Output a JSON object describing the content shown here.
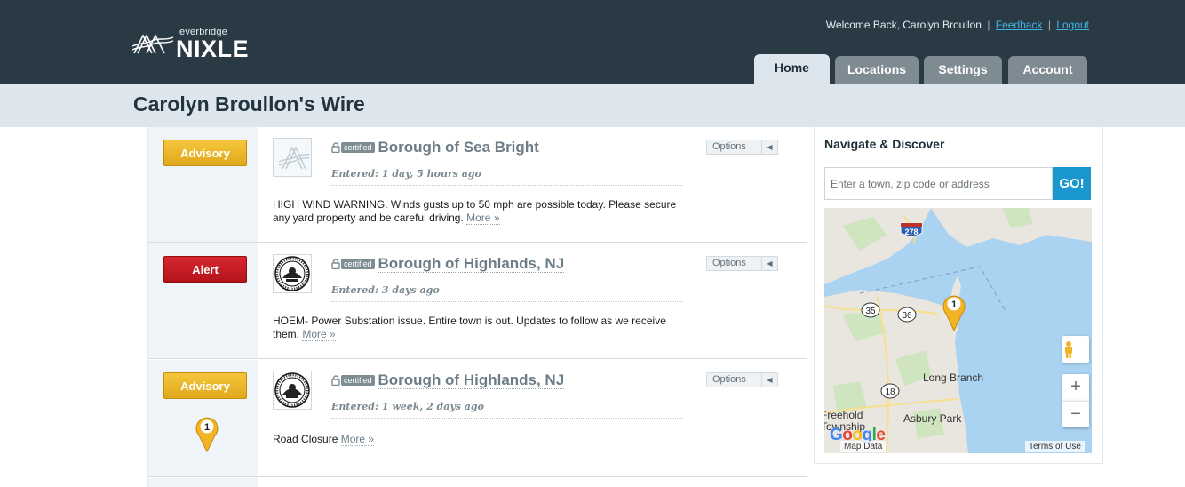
{
  "header": {
    "logo_small": "everbridge",
    "logo_large": "NIXLE",
    "welcome_text": "Welcome Back, Carolyn Broullon",
    "separator": "|",
    "feedback_label": "Feedback",
    "logout_label": "Logout",
    "tabs": [
      {
        "label": "Home",
        "active": true
      },
      {
        "label": "Locations",
        "active": false
      },
      {
        "label": "Settings",
        "active": false
      },
      {
        "label": "Account",
        "active": false
      }
    ]
  },
  "page_title": "Carolyn Broullon's Wire",
  "feed": [
    {
      "badge": "Advisory",
      "certified": "certified",
      "agency": "Borough of Sea Bright",
      "entered": "Entered: 1 day, 5 hours ago",
      "message": "HIGH WIND WARNING. Winds gusts up to 50 mph are possible today. Please secure any yard property and be careful driving.",
      "more": "More »",
      "options": "Options"
    },
    {
      "badge": "Alert",
      "certified": "certified",
      "agency": "Borough of Highlands, NJ",
      "entered": "Entered: 3 days ago",
      "message": "HOEM- Power Substation issue. Entire town is out. Updates to follow as we receive them.",
      "more": "More »",
      "options": "Options"
    },
    {
      "badge": "Advisory",
      "pin_number": "1",
      "certified": "certified",
      "agency": "Borough of Highlands, NJ",
      "entered": "Entered: 1 week, 2 days ago",
      "message": "Road Closure",
      "more": "More »",
      "options": "Options"
    }
  ],
  "sidebar": {
    "title": "Navigate & Discover",
    "search_placeholder": "Enter a town, zip code or address",
    "go_label": "GO!",
    "map": {
      "pin_number": "1",
      "shields": [
        "278",
        "35",
        "36",
        "18"
      ],
      "places": [
        "Long Branch",
        "Freehold",
        "Township",
        "Asbury Park"
      ],
      "map_data": "Map Data",
      "terms": "Terms of Use",
      "google": "Google",
      "zoom_in": "+",
      "zoom_out": "−"
    }
  },
  "colors": {
    "header_bg": "#2a3a44",
    "subbar_bg": "#dde6ec",
    "advisory": "#f1bf34",
    "alert": "#c91d25",
    "link": "#41b4e6",
    "go_button": "#1a97cf",
    "water": "#a9d3f1"
  }
}
